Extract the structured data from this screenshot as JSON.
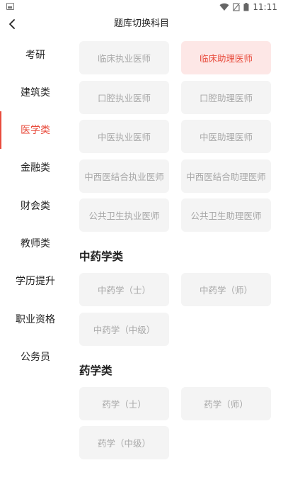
{
  "status_bar": {
    "time": "11:11",
    "icons": [
      "image-icon",
      "wifi-icon",
      "no-sim-icon",
      "battery-icon"
    ]
  },
  "header": {
    "title": "题库切换科目",
    "back_icon": "chevron-left-icon"
  },
  "colors": {
    "accent": "#e84c3d",
    "chip_background": "#f4f4f4",
    "chip_active_background": "#fde7e6",
    "chip_text": "#a8a8a8"
  },
  "sidebar": {
    "items": [
      {
        "label": "考研"
      },
      {
        "label": "建筑类"
      },
      {
        "label": "医学类",
        "active": true
      },
      {
        "label": "金融类"
      },
      {
        "label": "财会类"
      },
      {
        "label": "教师类"
      },
      {
        "label": "学历提升"
      },
      {
        "label": "职业资格"
      },
      {
        "label": "公务员"
      }
    ]
  },
  "main": {
    "groups": [
      {
        "title": "",
        "items": [
          {
            "label": "临床执业医师"
          },
          {
            "label": "临床助理医师",
            "selected": true
          },
          {
            "label": "口腔执业医师"
          },
          {
            "label": "口腔助理医师"
          },
          {
            "label": "中医执业医师"
          },
          {
            "label": "中医助理医师"
          },
          {
            "label": "中西医结合执业医师"
          },
          {
            "label": "中西医结合助理医师"
          },
          {
            "label": "公共卫生执业医师"
          },
          {
            "label": "公共卫生助理医师"
          }
        ]
      },
      {
        "title": "中药学类",
        "items": [
          {
            "label": "中药学（士）"
          },
          {
            "label": "中药学（师）"
          },
          {
            "label": "中药学（中级）"
          }
        ]
      },
      {
        "title": "药学类",
        "items": [
          {
            "label": "药学（士）"
          },
          {
            "label": "药学（师）"
          },
          {
            "label": "药学（中级）"
          }
        ]
      }
    ]
  }
}
